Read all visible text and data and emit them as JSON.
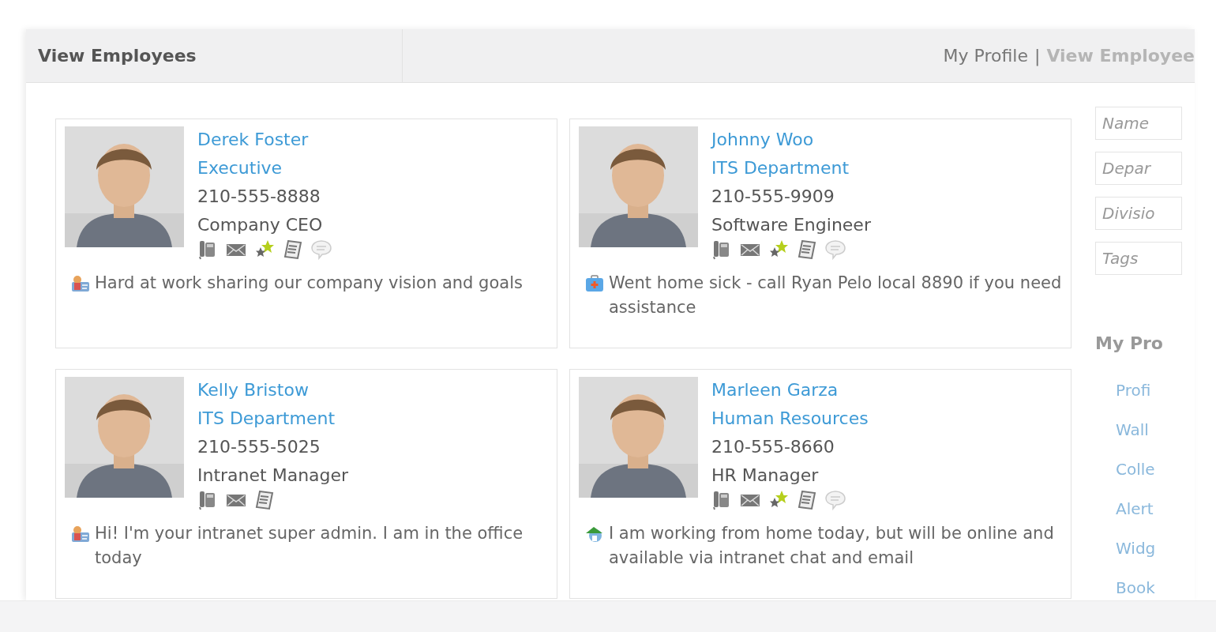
{
  "header": {
    "title": "View Employees",
    "separator": "|",
    "links": [
      {
        "label": "My Profile",
        "selected": false
      },
      {
        "label": "View Employee",
        "selected": true
      }
    ]
  },
  "employees": [
    {
      "name": "Derek Foster",
      "department": "Executive",
      "phone": "210-555-8888",
      "job_title": "Company CEO",
      "photo": {
        "kind": "picture"
      },
      "icons": [
        {
          "kind": "phone"
        },
        {
          "kind": "mail"
        },
        {
          "kind": "favorite"
        },
        {
          "kind": "notes"
        },
        {
          "kind": "chat"
        }
      ],
      "status": {
        "kind": "person",
        "text": "Hard at work sharing our company vision and goals"
      }
    },
    {
      "name": "Johnny Woo",
      "department": "ITS Department",
      "phone": "210-555-9909",
      "job_title": "Software Engineer",
      "photo": {
        "kind": "picture"
      },
      "icons": [
        {
          "kind": "phone"
        },
        {
          "kind": "mail"
        },
        {
          "kind": "favorite"
        },
        {
          "kind": "notes"
        },
        {
          "kind": "chat"
        }
      ],
      "status": {
        "kind": "medkit",
        "text": "Went home sick - call Ryan Pelo local 8890 if you need assistance"
      }
    },
    {
      "name": "Kelly Bristow",
      "department": "ITS Department",
      "phone": "210-555-5025",
      "job_title": "Intranet Manager",
      "photo": {
        "kind": "picture"
      },
      "icons": [
        {
          "kind": "phone"
        },
        {
          "kind": "mail"
        },
        {
          "kind": "notes"
        }
      ],
      "status": {
        "kind": "person",
        "text": "Hi! I'm your intranet super admin. I am in the office today"
      }
    },
    {
      "name": "Marleen Garza",
      "department": "Human Resources",
      "phone": "210-555-8660",
      "job_title": "HR Manager",
      "photo": {
        "kind": "picture"
      },
      "icons": [
        {
          "kind": "phone"
        },
        {
          "kind": "mail"
        },
        {
          "kind": "favorite"
        },
        {
          "kind": "notes"
        },
        {
          "kind": "chat"
        }
      ],
      "status": {
        "kind": "home",
        "text": "I am working from home today, but will be online and available via intranet chat and email"
      }
    }
  ],
  "sidebar": {
    "filters": [
      {
        "placeholder": "Name"
      },
      {
        "placeholder": "Depar"
      },
      {
        "placeholder": "Divisio"
      },
      {
        "placeholder": "Tags"
      }
    ],
    "heading": "My Pro",
    "items": [
      "Profi",
      "Wall",
      "Colle",
      "Alert",
      "Widg",
      "Book"
    ]
  }
}
